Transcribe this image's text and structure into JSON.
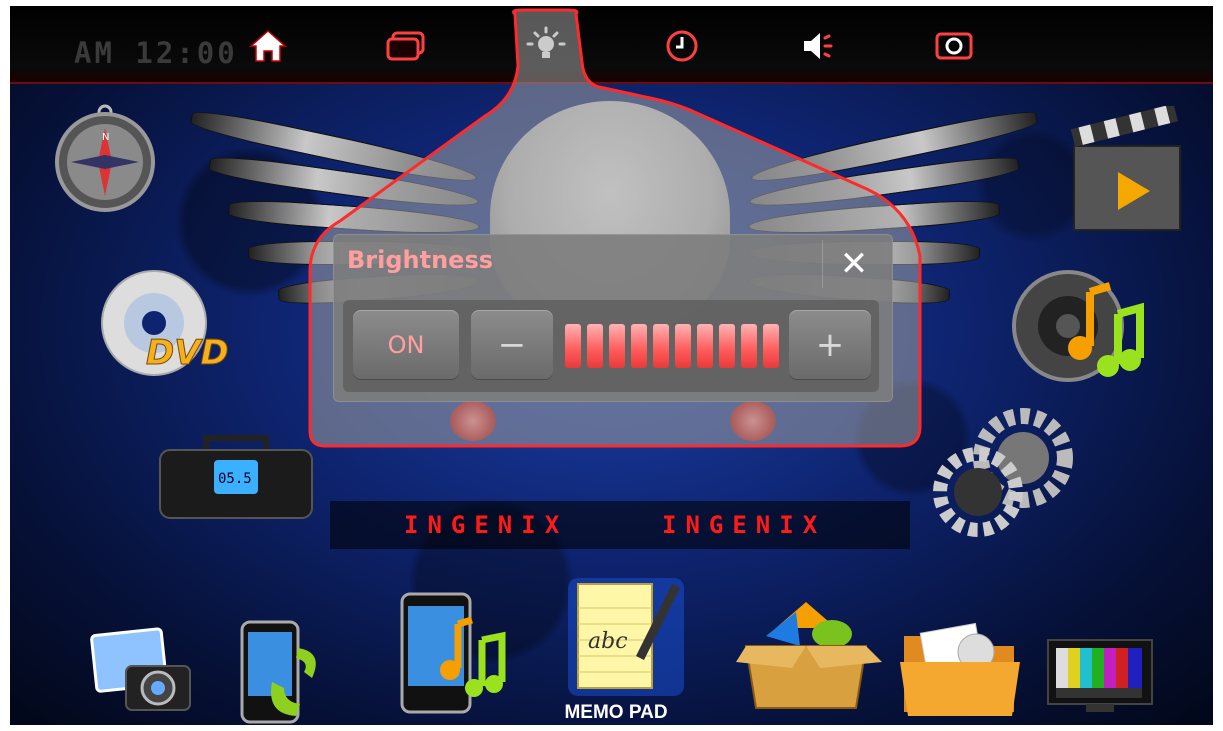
{
  "status_bar": {
    "clock": "AM 12:00",
    "icons": [
      "home-icon",
      "window-icon",
      "brightness-icon",
      "clock-icon",
      "volume-icon",
      "camera-icon"
    ],
    "active_icon": "brightness-icon",
    "accent_color": "#ff2a2a"
  },
  "brightness_popup": {
    "title": "Brightness",
    "close_symbol": "✕",
    "on_label": "ON",
    "minus_symbol": "−",
    "plus_symbol": "+",
    "level_segments": 10,
    "level_filled": 10
  },
  "brand": {
    "left": "INGENIX",
    "right": "INGENIX"
  },
  "left_apps": [
    "compass-icon",
    "dvd-icon",
    "radio-icon"
  ],
  "right_apps": [
    "video-clapper-icon",
    "music-speaker-icon",
    "settings-gears-icon"
  ],
  "dock": {
    "apps": [
      "photo-camera-icon",
      "phone-icon",
      "phone-music-icon",
      "memo-pad-icon",
      "app-box-icon",
      "folder-icon",
      "tv-test-pattern-icon"
    ],
    "selected": "memo-pad-icon",
    "selected_label": "MEMO PAD"
  }
}
